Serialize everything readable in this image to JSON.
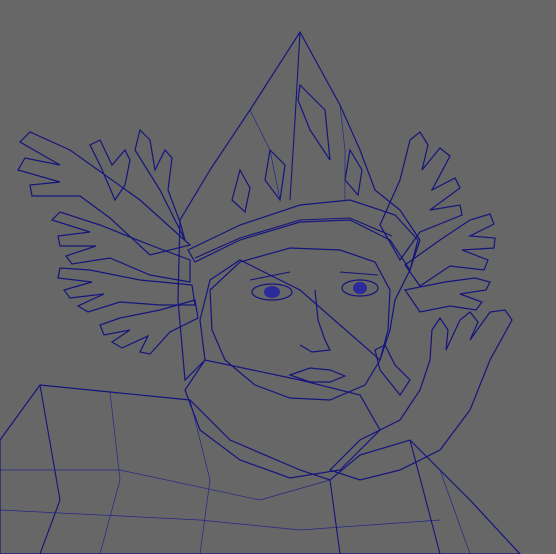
{
  "viewport": {
    "background_color": "#676767",
    "mesh_color": "#b8b8b8",
    "wireframe_color": "#1c1c8e",
    "subject": "wireframe-bust-with-helmet-and-hand-wings",
    "num_hands_left": 5,
    "num_hands_right": 4
  }
}
